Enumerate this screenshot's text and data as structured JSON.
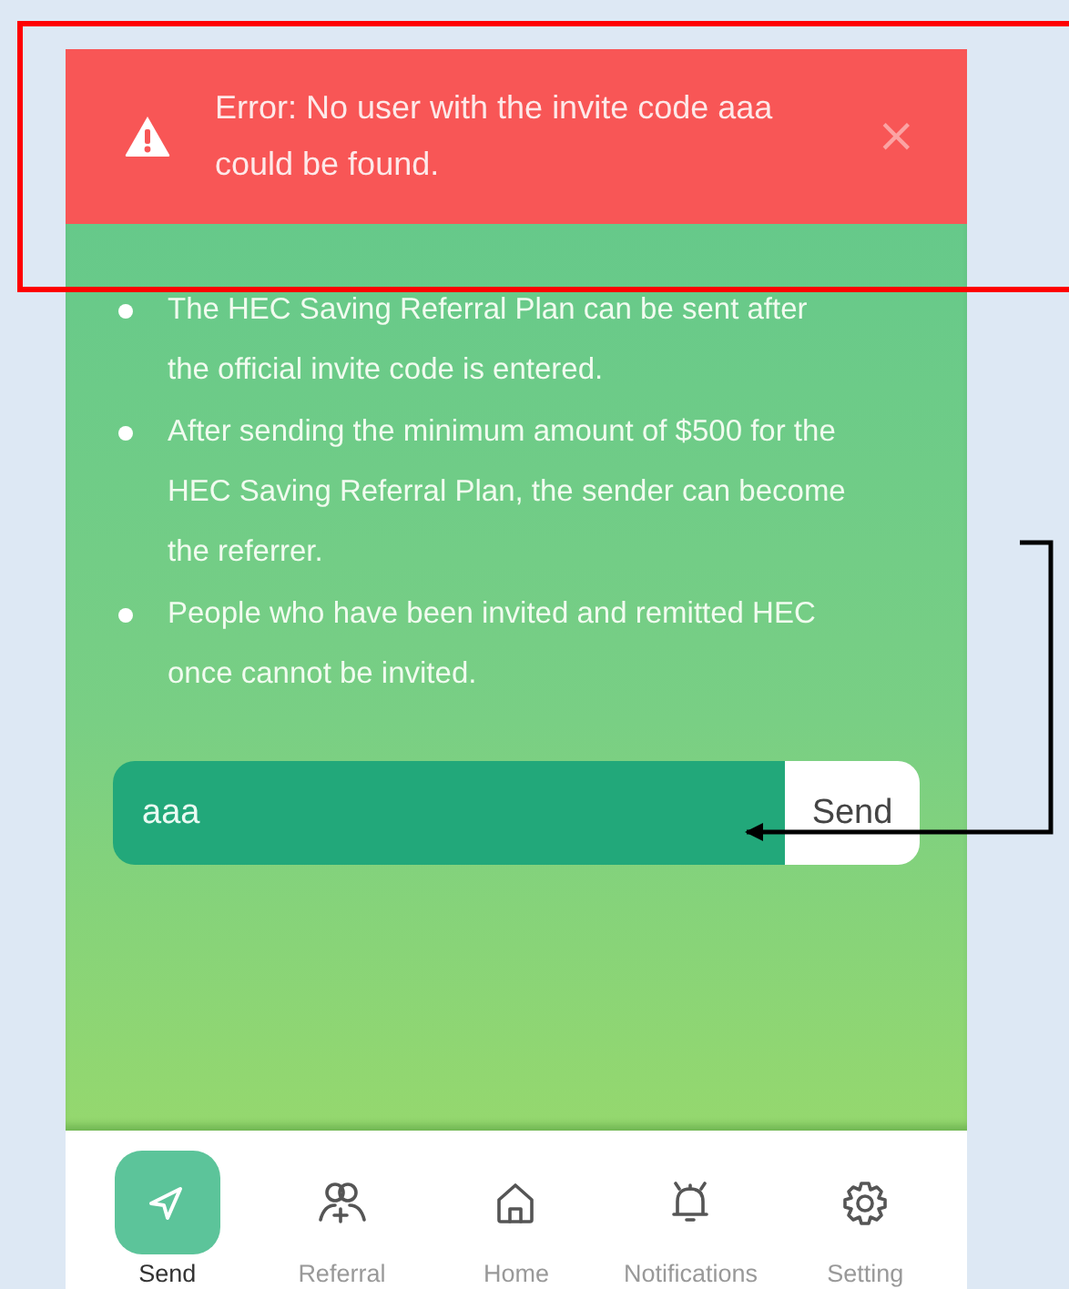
{
  "error_banner": {
    "message": "Error: No user with the invite code aaa could be found.",
    "close": "×"
  },
  "rules": [
    "The HEC Saving Referral Plan can be sent after the official invite code is entered.",
    "After sending the minimum amount of $500 for the HEC Saving Referral Plan, the sender can become the referrer.",
    "People who have been invited and remitted HEC once cannot be invited."
  ],
  "invite_form": {
    "value": "aaa",
    "button": "Send"
  },
  "nav": [
    {
      "label": "Send",
      "selected": true
    },
    {
      "label": "Referral",
      "selected": false
    },
    {
      "label": "Home",
      "selected": false
    },
    {
      "label": "Notifications",
      "selected": false
    },
    {
      "label": "Setting",
      "selected": false
    }
  ]
}
